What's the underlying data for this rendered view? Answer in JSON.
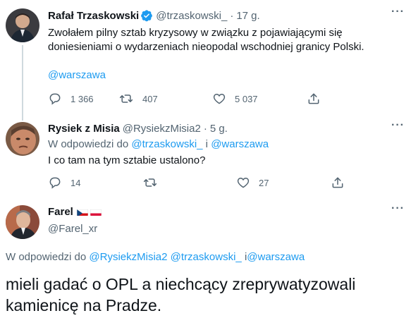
{
  "tweet1": {
    "name": "Rafał Trzaskowski",
    "handle": "@trzaskowski_",
    "dot": "·",
    "time": "17 g.",
    "text": "Zwołałem pilny sztab kryzysowy w związku z pojawiającymi się doniesieniami o wydarzeniach nieopodal wschodniej granicy Polski.",
    "mention": "@warszawa",
    "replies": "1 366",
    "retweets": "407",
    "likes": "5 037"
  },
  "tweet2": {
    "name": "Rysiek z Misia",
    "handle": "@RysiekzMisia2",
    "dot": "·",
    "time": "5 g.",
    "reply_prefix": "W odpowiedzi do",
    "reply_user1": "@trzaskowski_",
    "reply_and": "i",
    "reply_user2": "@warszawa",
    "text": "I co tam na tym sztabie ustalono?",
    "replies": "14",
    "retweets": "",
    "likes": "27"
  },
  "tweet3": {
    "name": "Farel",
    "handle": "@Farel_xr",
    "reply_prefix": "W odpowiedzi do",
    "reply_user1": "@RysiekzMisia2",
    "reply_user2": "@trzaskowski_",
    "reply_and": "i",
    "reply_user3": "@warszawa",
    "text": "mieli gadać o OPL a niechcący zreprywatyzowali kamienicę na Pradze."
  },
  "icons": {
    "reply": "reply-icon",
    "retweet": "retweet-icon",
    "like": "heart-icon",
    "share": "share-icon",
    "more": "more-icon",
    "verified": "verified-badge-icon",
    "flag_cz": "czech-flag-icon",
    "flag_pl": "polish-flag-icon"
  },
  "colors": {
    "accent": "#1d9bf0",
    "text": "#0f1419",
    "muted": "#536471",
    "thread_line": "#cfd9de"
  }
}
